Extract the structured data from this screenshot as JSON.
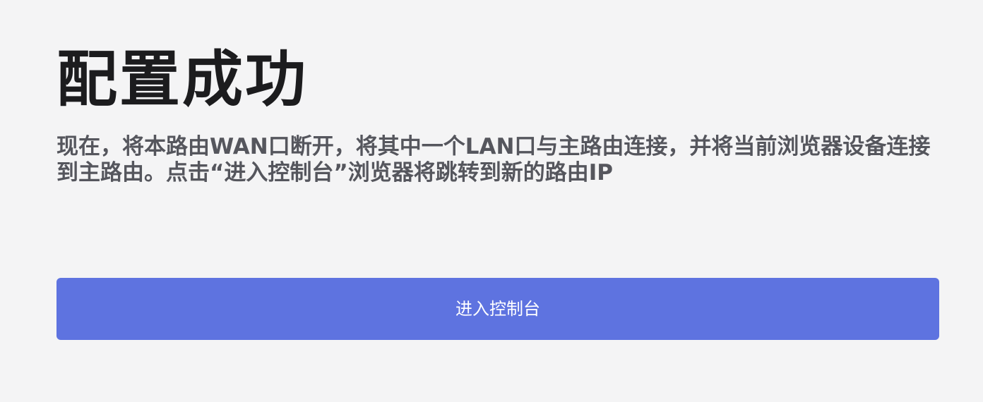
{
  "page": {
    "title": "配置成功",
    "description": "现在，将本路由WAN口断开，将其中一个LAN口与主路由连接，并将当前浏览器设备连接到主路由。点击“进入控制台”浏览器将跳转到新的路由IP",
    "button_label": "进入控制台"
  },
  "colors": {
    "background": "#f4f4f5",
    "title": "#1c1c1e",
    "description": "#55565d",
    "button_background": "#5e73e0",
    "button_text": "#ffffff"
  }
}
